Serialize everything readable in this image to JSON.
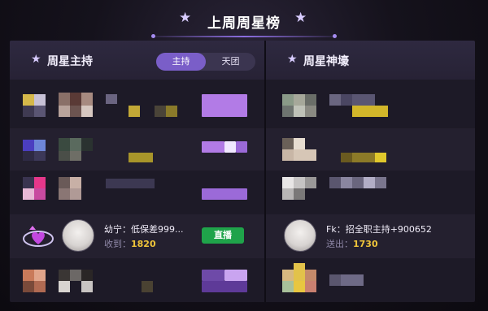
{
  "header": {
    "title": "上周周星榜"
  },
  "left": {
    "title": "周星主持",
    "tabs": [
      {
        "label": "主持",
        "active": true
      },
      {
        "label": "天团",
        "active": false
      }
    ],
    "highlight": {
      "name": "幼宁：低保差999...",
      "stat_label": "收到：",
      "stat_value": "1820",
      "action_label": "直播"
    }
  },
  "right": {
    "title": "周星神壕",
    "highlight": {
      "name": "Fk：招全职主持+900652",
      "stat_label": "送出：",
      "stat_value": "1730"
    }
  },
  "colors": {
    "accent": "#7a5ec8",
    "live": "#1fa34a",
    "number": "#f0c53a"
  }
}
